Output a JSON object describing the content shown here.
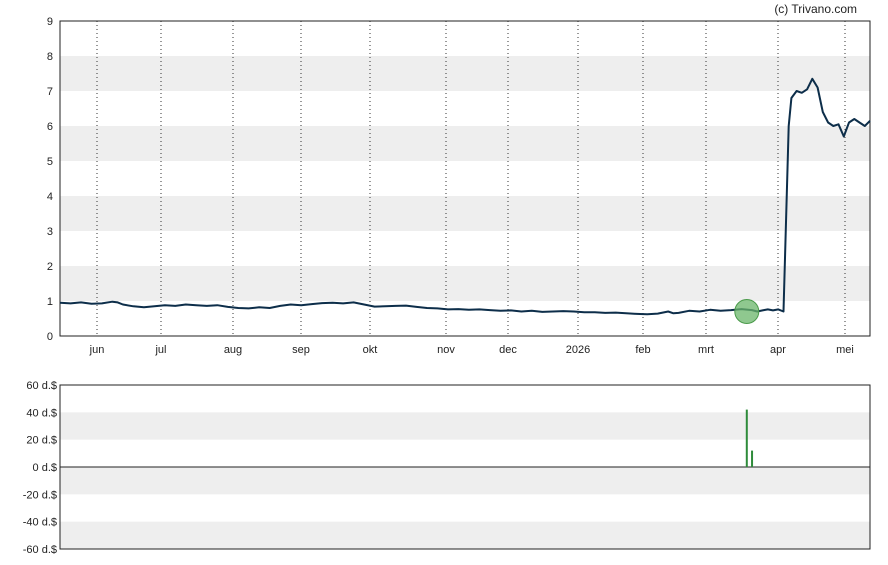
{
  "credit": "(c) Trivano.com",
  "chart_data": [
    {
      "type": "line",
      "ylim": [
        0,
        9
      ],
      "yticks": [
        "0",
        "1",
        "2",
        "3",
        "4",
        "5",
        "6",
        "7",
        "8",
        "9"
      ],
      "xticks": [
        "jun",
        "jul",
        "aug",
        "sep",
        "okt",
        "nov",
        "dec",
        "2026",
        "feb",
        "mrt",
        "apr",
        "mei"
      ],
      "grid": true,
      "line_color": "#0d2e4a",
      "band_color": "#eeeeee",
      "series": [
        {
          "x": [
            0,
            4,
            8,
            12,
            16,
            20,
            22,
            24,
            28,
            32,
            36,
            40,
            44,
            48,
            52,
            56,
            60,
            64,
            68,
            72,
            76,
            80,
            84,
            88,
            92,
            96,
            100,
            104,
            108,
            112,
            116,
            120,
            124,
            128,
            132,
            136,
            140,
            144,
            148,
            152,
            156,
            160,
            164,
            168,
            172,
            176,
            180,
            184,
            188,
            192,
            196,
            200,
            204,
            208,
            212,
            216,
            220,
            224,
            228,
            232,
            234,
            236,
            240,
            244,
            248,
            252,
            256,
            260,
            264,
            266,
            268,
            270,
            272,
            274,
            276,
            278,
            279,
            281,
            283,
            285,
            287,
            289,
            291,
            293,
            295,
            297,
            299,
            301,
            303,
            305,
            307,
            309
          ],
          "values": [
            0.95,
            0.93,
            0.96,
            0.92,
            0.93,
            0.98,
            0.96,
            0.9,
            0.85,
            0.82,
            0.85,
            0.88,
            0.86,
            0.9,
            0.88,
            0.86,
            0.88,
            0.83,
            0.8,
            0.79,
            0.82,
            0.8,
            0.86,
            0.9,
            0.88,
            0.91,
            0.94,
            0.95,
            0.93,
            0.96,
            0.9,
            0.84,
            0.85,
            0.86,
            0.87,
            0.83,
            0.8,
            0.79,
            0.76,
            0.77,
            0.75,
            0.76,
            0.74,
            0.72,
            0.73,
            0.7,
            0.72,
            0.69,
            0.7,
            0.71,
            0.7,
            0.68,
            0.68,
            0.66,
            0.67,
            0.65,
            0.63,
            0.62,
            0.64,
            0.7,
            0.65,
            0.66,
            0.72,
            0.7,
            0.75,
            0.72,
            0.74,
            0.77,
            0.74,
            0.7,
            0.73,
            0.76,
            0.73,
            0.76,
            0.7,
            6.0,
            6.8,
            7.0,
            6.95,
            7.05,
            7.35,
            7.1,
            6.4,
            6.1,
            6.0,
            6.05,
            5.7,
            6.1,
            6.2,
            6.1,
            6.0,
            6.15
          ]
        }
      ],
      "marker": {
        "x": 262,
        "value": 0.7,
        "color": "#6ab56a"
      }
    },
    {
      "type": "bar",
      "ylim": [
        -60,
        60
      ],
      "yticks": [
        "60 d.$",
        "40 d.$",
        "20 d.$",
        "0 d.$",
        "-20 d.$",
        "-40 d.$",
        "-60 d.$"
      ],
      "bar_color": "#2e8b3a",
      "x": [
        262,
        264
      ],
      "values": [
        42,
        12
      ]
    }
  ]
}
